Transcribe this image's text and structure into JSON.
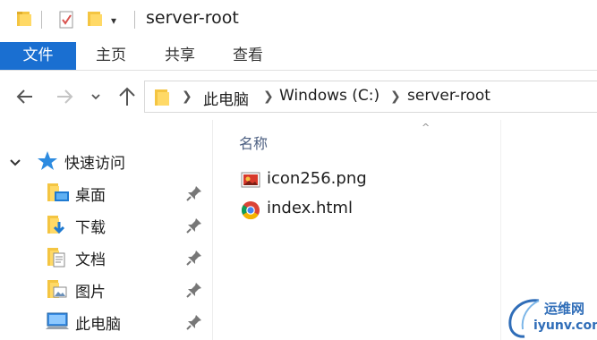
{
  "window": {
    "title": "server-root",
    "quick_access_toolbar": {
      "icons": [
        "folder-icon",
        "properties-icon",
        "new-folder-icon",
        "customize-dropdown-icon"
      ],
      "dropdown_glyph": "▾"
    }
  },
  "ribbon": {
    "tabs": [
      {
        "label": "文件",
        "active": true
      },
      {
        "label": "主页",
        "active": false
      },
      {
        "label": "共享",
        "active": false
      },
      {
        "label": "查看",
        "active": false
      }
    ],
    "active_color": "#1a6fd1"
  },
  "navigation": {
    "back_icon": "arrow-left-icon",
    "forward_icon": "arrow-right-icon",
    "recent_icon": "chevron-down-icon",
    "up_icon": "arrow-up-icon"
  },
  "address_bar": {
    "breadcrumbs": [
      "此电脑",
      "Windows (C:)",
      "server-root"
    ]
  },
  "nav_pane": {
    "quick_access": {
      "label": "快速访问",
      "icon": "star-icon",
      "expanded": true
    },
    "items": [
      {
        "label": "桌面",
        "icon": "desktop-folder-icon",
        "pinned": true
      },
      {
        "label": "下载",
        "icon": "downloads-folder-icon",
        "pinned": true
      },
      {
        "label": "文档",
        "icon": "documents-folder-icon",
        "pinned": true
      },
      {
        "label": "图片",
        "icon": "pictures-folder-icon",
        "pinned": true
      },
      {
        "label": "此电脑",
        "icon": "this-pc-icon",
        "pinned": true
      }
    ]
  },
  "content": {
    "column_header": "名称",
    "sort_glyph": "^",
    "files": [
      {
        "name": "icon256.png",
        "icon": "image-file-icon"
      },
      {
        "name": "index.html",
        "icon": "chrome-html-file-icon"
      }
    ]
  },
  "watermark": {
    "text_cn": "运维网",
    "url": "iyunv.com"
  }
}
